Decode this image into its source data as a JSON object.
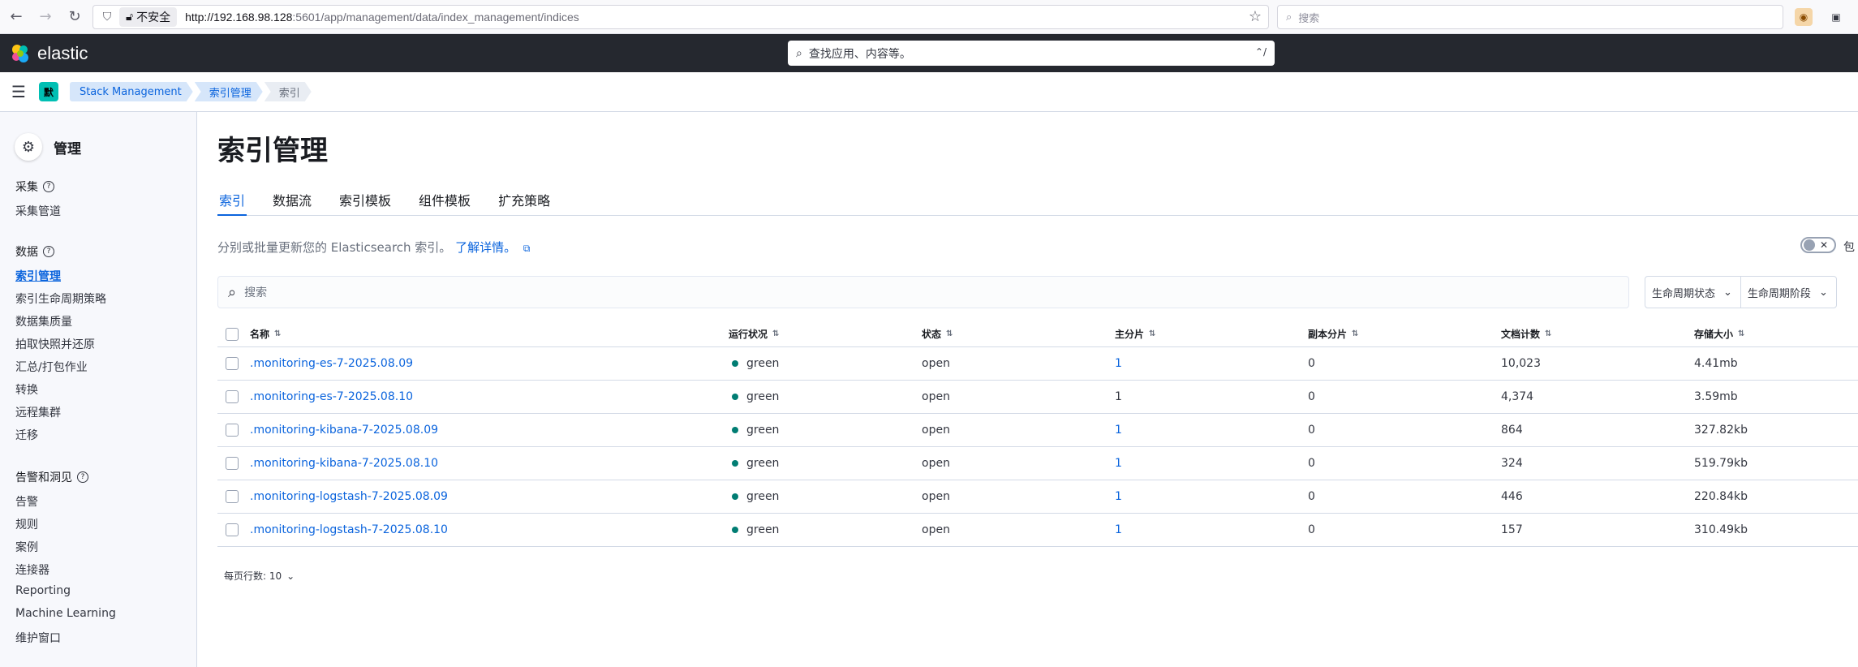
{
  "browser": {
    "insecure_label": "不安全",
    "url_host": "http://192.168.98.128",
    "url_rest": ":5601/app/management/data/index_management/indices",
    "search_placeholder": "搜索"
  },
  "header": {
    "logo_text": "elastic",
    "search_placeholder": "查找应用、内容等。",
    "search_shortcut": "⌃/"
  },
  "subheader": {
    "space_initial": "默",
    "breadcrumbs": [
      "Stack Management",
      "索引管理",
      "索引"
    ]
  },
  "sidebar": {
    "title": "管理",
    "groups": [
      {
        "title": "采集",
        "items": [
          "采集管道"
        ]
      },
      {
        "title": "数据",
        "items": [
          "索引管理",
          "索引生命周期策略",
          "数据集质量",
          "拍取快照并还原",
          "汇总/打包作业",
          "转换",
          "远程集群",
          "迁移"
        ]
      },
      {
        "title": "告警和洞见",
        "items": [
          "告警",
          "规则",
          "案例",
          "连接器",
          "Reporting",
          "Machine Learning",
          "维护窗口"
        ]
      }
    ],
    "active_item": "索引管理"
  },
  "main": {
    "title": "索引管理",
    "tabs": [
      "索引",
      "数据流",
      "索引模板",
      "组件模板",
      "扩充策略"
    ],
    "active_tab": "索引",
    "description": "分别或批量更新您的 Elasticsearch 索引。",
    "learn_more": "了解详情。",
    "toggle_label": "包",
    "search_placeholder": "搜索",
    "filters": [
      "生命周期状态",
      "生命周期阶段"
    ],
    "table": {
      "columns": [
        "名称",
        "运行状况",
        "状态",
        "主分片",
        "副本分片",
        "文档计数",
        "存储大小"
      ],
      "rows": [
        {
          "name": ".monitoring-es-7-2025.08.09",
          "health": "green",
          "status": "open",
          "primary": "1",
          "replicas": "0",
          "docs": "10,023",
          "size": "4.41mb"
        },
        {
          "name": ".monitoring-es-7-2025.08.10",
          "health": "green",
          "status": "open",
          "primary": "1",
          "replicas": "0",
          "docs": "4,374",
          "size": "3.59mb"
        },
        {
          "name": ".monitoring-kibana-7-2025.08.09",
          "health": "green",
          "status": "open",
          "primary": "1",
          "replicas": "0",
          "docs": "864",
          "size": "327.82kb"
        },
        {
          "name": ".monitoring-kibana-7-2025.08.10",
          "health": "green",
          "status": "open",
          "primary": "1",
          "replicas": "0",
          "docs": "324",
          "size": "519.79kb"
        },
        {
          "name": ".monitoring-logstash-7-2025.08.09",
          "health": "green",
          "status": "open",
          "primary": "1",
          "replicas": "0",
          "docs": "446",
          "size": "220.84kb"
        },
        {
          "name": ".monitoring-logstash-7-2025.08.10",
          "health": "green",
          "status": "open",
          "primary": "1",
          "replicas": "0",
          "docs": "157",
          "size": "310.49kb"
        }
      ]
    },
    "rows_per_page": "每页行数: 10"
  },
  "colors": {
    "accent": "#0b64dd",
    "health_green": "#017d73",
    "header_bg": "#25282f"
  }
}
